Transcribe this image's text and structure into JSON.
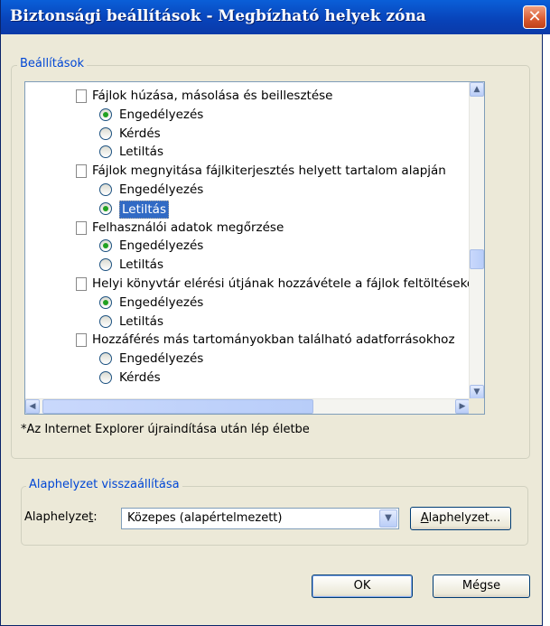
{
  "window": {
    "title": "Biztonsági beállítások - Megbízható helyek zóna"
  },
  "settings": {
    "legend": "Beállítások",
    "items": [
      {
        "kind": "header",
        "label": "Fájlok húzása, másolása és beillesztése"
      },
      {
        "kind": "option",
        "label": "Engedélyezés",
        "checked": true
      },
      {
        "kind": "option",
        "label": "Kérdés",
        "checked": false
      },
      {
        "kind": "option",
        "label": "Letiltás",
        "checked": false
      },
      {
        "kind": "header",
        "label": "Fájlok megnyitása fájlkiterjesztés helyett tartalom alapján"
      },
      {
        "kind": "option",
        "label": "Engedélyezés",
        "checked": false
      },
      {
        "kind": "option",
        "label": "Letiltás",
        "checked": true,
        "selected": true
      },
      {
        "kind": "header",
        "label": "Felhasználói adatok megőrzése"
      },
      {
        "kind": "option",
        "label": "Engedélyezés",
        "checked": true
      },
      {
        "kind": "option",
        "label": "Letiltás",
        "checked": false
      },
      {
        "kind": "header",
        "label": "Helyi könyvtár elérési útjának hozzávétele a fájlok feltöltésekor"
      },
      {
        "kind": "option",
        "label": "Engedélyezés",
        "checked": true
      },
      {
        "kind": "option",
        "label": "Letiltás",
        "checked": false
      },
      {
        "kind": "header",
        "label": "Hozzáférés más tartományokban található adatforrásokhoz"
      },
      {
        "kind": "option",
        "label": "Engedélyezés",
        "checked": false
      },
      {
        "kind": "option",
        "label": "Kérdés",
        "checked": false
      }
    ],
    "note": "*Az Internet Explorer újraindítása után lép életbe"
  },
  "reset": {
    "legend": "Alaphelyzet visszaállítása",
    "label_prefix": "Alaphelyze",
    "label_accel": "t",
    "label_suffix": ":",
    "dropdown_value": "Közepes (alapértelmezett)",
    "button_accel": "A",
    "button_rest": "laphelyzet..."
  },
  "buttons": {
    "ok": "OK",
    "cancel": "Mégse"
  },
  "icons": {
    "close": "close-icon",
    "scroll_up": "chevron-up-icon",
    "scroll_down": "chevron-down-icon",
    "scroll_left": "chevron-left-icon",
    "scroll_right": "chevron-right-icon",
    "dropdown": "chevron-down-icon",
    "setting": "document-icon"
  }
}
